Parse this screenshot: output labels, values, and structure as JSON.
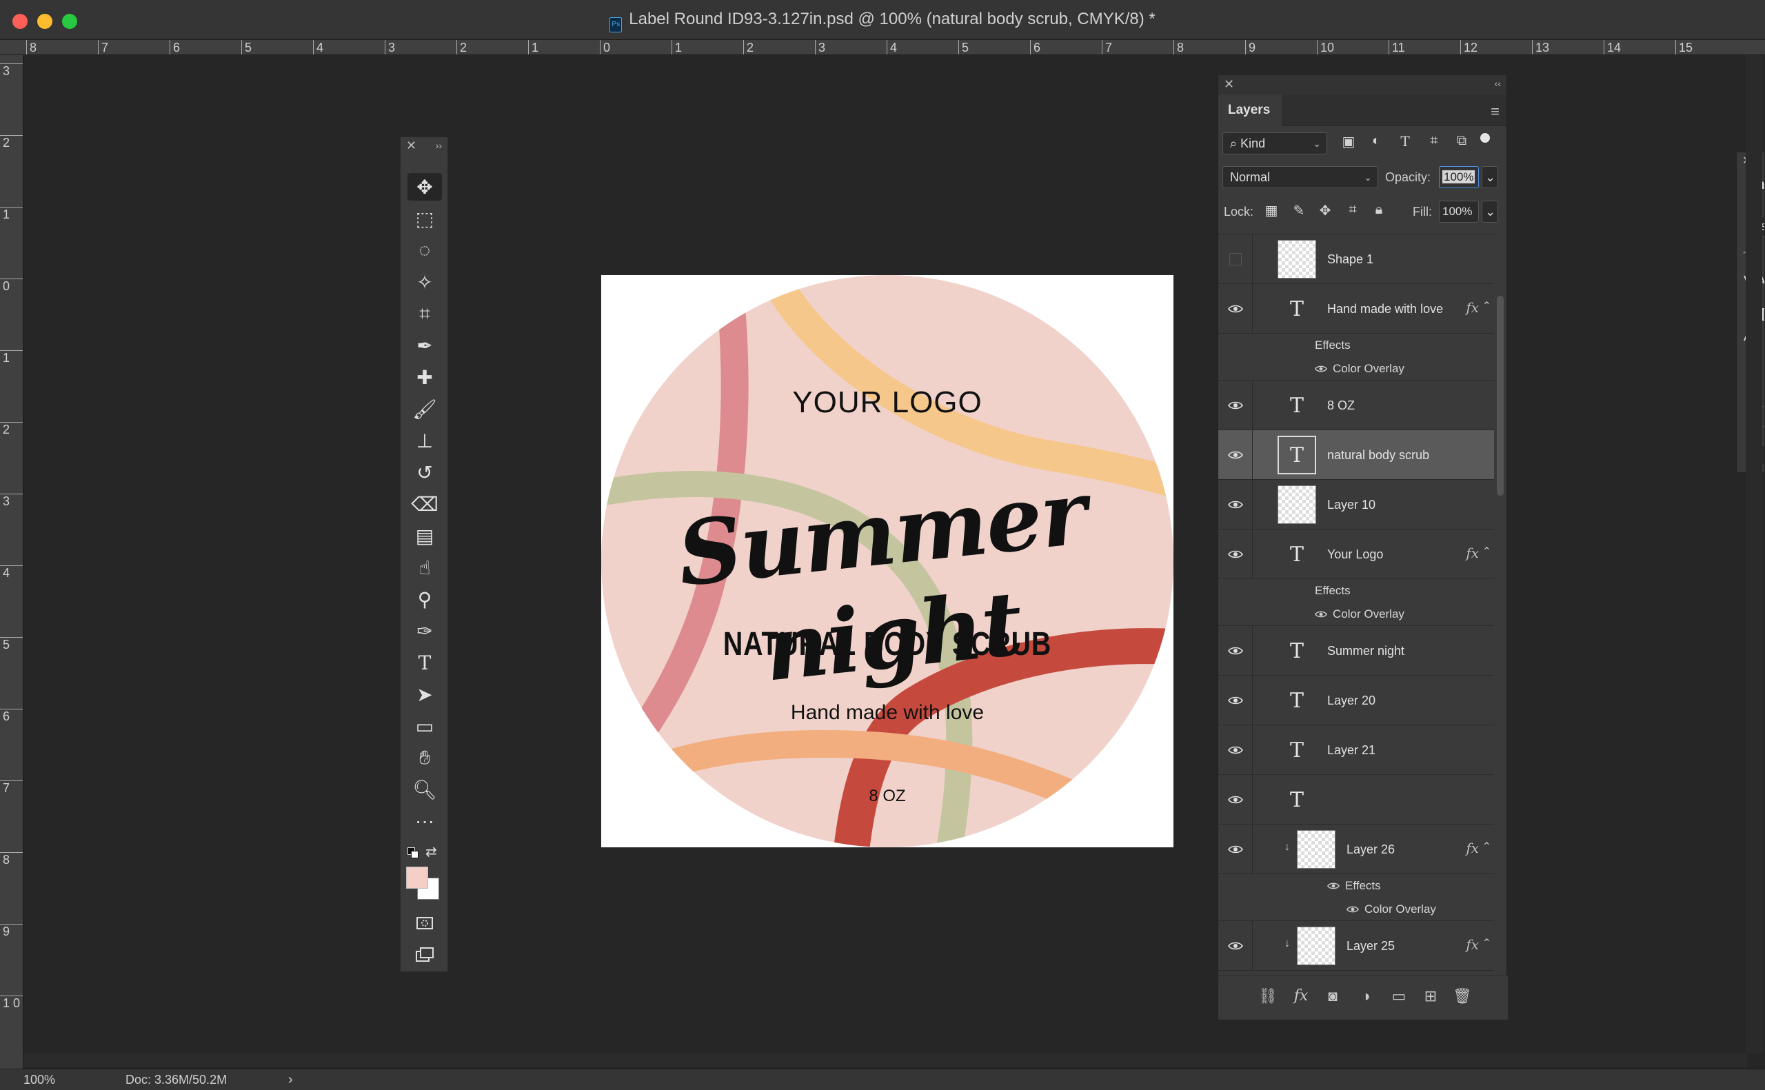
{
  "window": {
    "title": "Label Round ID93-3.127in.psd @ 100% (natural body scrub, CMYK/8) *",
    "file_icon": "Ps"
  },
  "rulers": {
    "horizontal": [
      "8",
      "7",
      "6",
      "5",
      "4",
      "3",
      "2",
      "1",
      "0",
      "1",
      "2",
      "3",
      "4",
      "5",
      "6",
      "7",
      "8",
      "9",
      "10",
      "11",
      "12",
      "13",
      "14",
      "15"
    ],
    "vertical": [
      "3",
      "2",
      "1",
      "0",
      "1",
      "2",
      "3",
      "4",
      "5",
      "6",
      "7",
      "8",
      "9",
      "1 0"
    ]
  },
  "tools": [
    "move-tool-icon",
    "marquee-tool-icon",
    "lasso-tool-icon",
    "magic-wand-tool-icon",
    "crop-tool-icon",
    "eyedropper-tool-icon",
    "healing-brush-tool-icon",
    "brush-tool-icon",
    "clone-stamp-tool-icon",
    "history-brush-tool-icon",
    "eraser-tool-icon",
    "gradient-tool-icon",
    "smudge-tool-icon",
    "dodge-tool-icon",
    "pen-tool-icon",
    "type-tool-icon",
    "path-selection-tool-icon",
    "rectangle-tool-icon",
    "hand-tool-icon",
    "zoom-tool-icon",
    "more-tools-icon"
  ],
  "colors": {
    "foreground": "#f3cfc8",
    "background": "#ffffff",
    "label_circle": "#f0d2cb",
    "stroke_yellow": "#f6c78a",
    "stroke_rose": "#dd8b8e",
    "stroke_sage": "#c4c59e",
    "stroke_red": "#c6493d",
    "stroke_peach": "#f2ae7e"
  },
  "canvas": {
    "logo": "YOUR LOGO",
    "title": "Summer night",
    "subtitle": "NATURAL BODY SCRUB",
    "tagline": "Hand made with love",
    "size": "8 OZ"
  },
  "layers_panel": {
    "tab": "Layers",
    "filter_kind": "Kind",
    "blend_mode": "Normal",
    "opacity_label": "Opacity:",
    "opacity_value": "100%",
    "lock_label": "Lock:",
    "fill_label": "Fill:",
    "fill_value": "100%",
    "effects_label": "Effects",
    "color_overlay_label": "Color Overlay",
    "fx_label": "fx",
    "layers": [
      {
        "name": "Shape 1",
        "type": "shape",
        "visible": false
      },
      {
        "name": "Hand made with love",
        "type": "text",
        "visible": true,
        "fx": true
      },
      {
        "name": "8 OZ",
        "type": "text",
        "visible": true
      },
      {
        "name": "natural body scrub",
        "type": "text",
        "visible": true,
        "selected": true
      },
      {
        "name": "Layer 10",
        "type": "image",
        "visible": true
      },
      {
        "name": "Your Logo",
        "type": "text",
        "visible": true,
        "fx": true
      },
      {
        "name": "Summer night",
        "type": "text",
        "visible": true
      },
      {
        "name": "Layer 20",
        "type": "text",
        "visible": true
      },
      {
        "name": "Layer 21",
        "type": "text",
        "visible": true
      },
      {
        "name": "",
        "type": "text",
        "visible": true
      },
      {
        "name": "Layer 26",
        "type": "image",
        "visible": true,
        "fx": true,
        "clipped": true
      },
      {
        "name": "Layer 25",
        "type": "image",
        "visible": true,
        "fx": true,
        "clipped": true
      }
    ]
  },
  "character_panel": {
    "tab_partial": "Ch",
    "field_partial": "Os",
    "button_partial": "E"
  },
  "status": {
    "zoom": "100%",
    "doc": "Doc: 3.36M/50.2M"
  }
}
